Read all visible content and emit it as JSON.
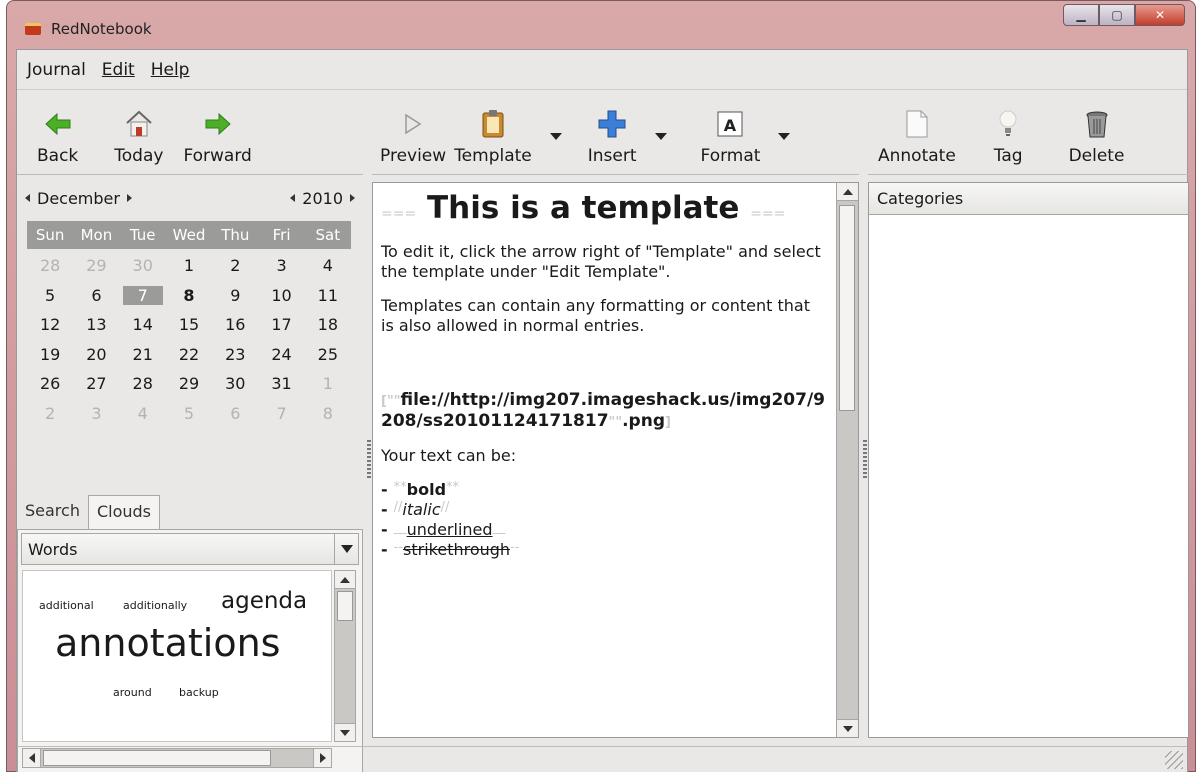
{
  "window": {
    "title": "RedNotebook"
  },
  "menu": {
    "journal": "Journal",
    "edit": "Edit",
    "help": "Help"
  },
  "nav_toolbar": {
    "back": "Back",
    "today": "Today",
    "forward": "Forward"
  },
  "editor_toolbar": {
    "preview": "Preview",
    "template": "Template",
    "insert": "Insert",
    "format": "Format"
  },
  "right_toolbar": {
    "annotate": "Annotate",
    "tag": "Tag",
    "delete": "Delete"
  },
  "calendar": {
    "month": "December",
    "year": "2010",
    "weekdays": [
      "Sun",
      "Mon",
      "Tue",
      "Wed",
      "Thu",
      "Fri",
      "Sat"
    ],
    "weeks": [
      [
        {
          "d": "28",
          "o": true
        },
        {
          "d": "29",
          "o": true
        },
        {
          "d": "30",
          "o": true
        },
        {
          "d": "1"
        },
        {
          "d": "2"
        },
        {
          "d": "3"
        },
        {
          "d": "4"
        }
      ],
      [
        {
          "d": "5"
        },
        {
          "d": "6"
        },
        {
          "d": "7",
          "sel": true
        },
        {
          "d": "8",
          "b": true
        },
        {
          "d": "9"
        },
        {
          "d": "10"
        },
        {
          "d": "11"
        }
      ],
      [
        {
          "d": "12"
        },
        {
          "d": "13"
        },
        {
          "d": "14"
        },
        {
          "d": "15"
        },
        {
          "d": "16"
        },
        {
          "d": "17"
        },
        {
          "d": "18"
        }
      ],
      [
        {
          "d": "19"
        },
        {
          "d": "20"
        },
        {
          "d": "21"
        },
        {
          "d": "22"
        },
        {
          "d": "23"
        },
        {
          "d": "24"
        },
        {
          "d": "25"
        }
      ],
      [
        {
          "d": "26"
        },
        {
          "d": "27"
        },
        {
          "d": "28"
        },
        {
          "d": "29"
        },
        {
          "d": "30"
        },
        {
          "d": "31"
        },
        {
          "d": "1",
          "o": true
        }
      ],
      [
        {
          "d": "2",
          "o": true
        },
        {
          "d": "3",
          "o": true
        },
        {
          "d": "4",
          "o": true
        },
        {
          "d": "5",
          "o": true
        },
        {
          "d": "6",
          "o": true
        },
        {
          "d": "7",
          "o": true
        },
        {
          "d": "8",
          "o": true
        }
      ]
    ]
  },
  "tabs": {
    "search": "Search",
    "clouds": "Clouds"
  },
  "cloud": {
    "combo_value": "Words",
    "words": {
      "additional": "additional",
      "additionally": "additionally",
      "agenda": "agenda",
      "annotations": "annotations",
      "around": "around",
      "backup": "backup"
    }
  },
  "editor": {
    "title_mark_open": "===",
    "title": "This is a template",
    "title_mark_close": "===",
    "p1": "To edit it, click the arrow right of \"Template\" and select the template under \"Edit Template\".",
    "p2": "Templates can contain any formatting or content that is also allowed in normal entries.",
    "link_open": "[",
    "link_quote": "\"\"",
    "link_text": "file://http://img207.imageshack.us/img207/9208/ss20101124171817",
    "link_ext": ".png",
    "link_close": "]",
    "p3": "Your text can be:",
    "list": [
      {
        "mark": "**",
        "text": "bold"
      },
      {
        "mark": "//",
        "text": "italic"
      },
      {
        "mark": "__",
        "text": "underlined"
      },
      {
        "mark": "--",
        "text": "strikethrough"
      }
    ]
  },
  "categories": {
    "header": "Categories"
  },
  "colors": {
    "accent_green": "#4caf27",
    "insert_blue": "#3d7fd6",
    "title_bar": "#d9a9a9"
  }
}
